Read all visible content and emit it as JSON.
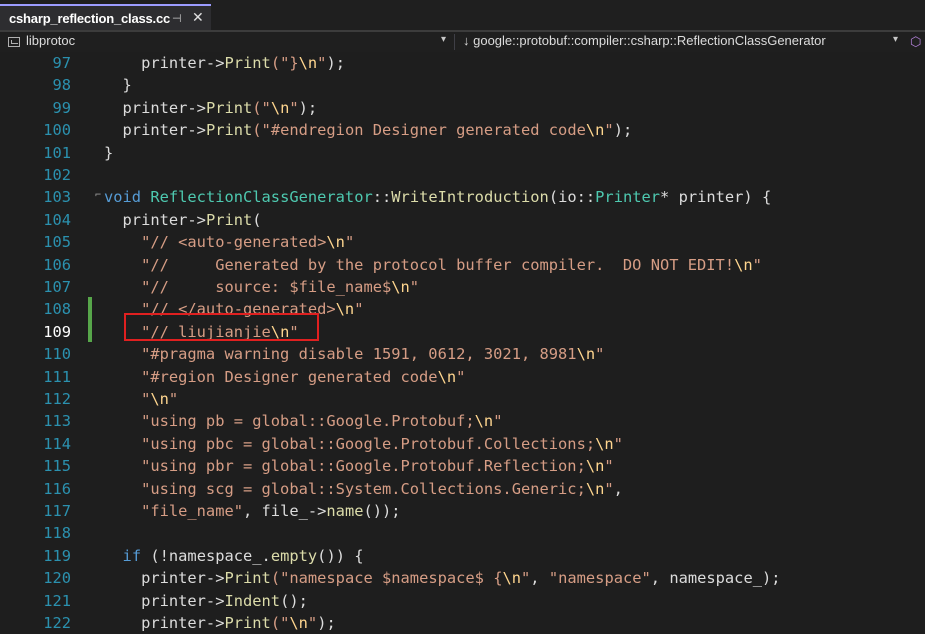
{
  "tab": {
    "title": "csharp_reflection_class.cc",
    "pin_glyph": "⊣",
    "close_glyph": "✕"
  },
  "nav": {
    "project": "libprotoc",
    "scope": "↓ google::protobuf::compiler::csharp::ReflectionClassGenerator"
  },
  "colors": {
    "plain": "#dcdcdc",
    "string": "#d69d85",
    "escape": "#ffd68f",
    "keyword": "#569cd6",
    "function": "#dcdcaa",
    "type": "#4ec9b0",
    "line_number": "#2b91af"
  },
  "lines": [
    {
      "n": "97",
      "tokens": [
        [
          "    printer->",
          "p"
        ],
        [
          "Print",
          "f"
        ],
        [
          "(\"}",
          "s"
        ],
        [
          "\\n",
          "e"
        ],
        [
          "\"",
          "s"
        ],
        [
          ");",
          "p"
        ]
      ]
    },
    {
      "n": "98",
      "tokens": [
        [
          "  }",
          "p"
        ]
      ]
    },
    {
      "n": "99",
      "tokens": [
        [
          "  printer->",
          "p"
        ],
        [
          "Print",
          "f"
        ],
        [
          "(\"",
          "s"
        ],
        [
          "\\n",
          "e"
        ],
        [
          "\"",
          "s"
        ],
        [
          ");",
          "p"
        ]
      ]
    },
    {
      "n": "100",
      "tokens": [
        [
          "  printer->",
          "p"
        ],
        [
          "Print",
          "f"
        ],
        [
          "(\"#endregion Designer generated code",
          "s"
        ],
        [
          "\\n",
          "e"
        ],
        [
          "\"",
          "s"
        ],
        [
          ");",
          "p"
        ]
      ]
    },
    {
      "n": "101",
      "tokens": [
        [
          "}",
          "p"
        ]
      ]
    },
    {
      "n": "102",
      "tokens": []
    },
    {
      "n": "103",
      "tokens": [
        [
          "void ",
          "k"
        ],
        [
          "ReflectionClassGenerator",
          "t"
        ],
        [
          "::",
          "p"
        ],
        [
          "WriteIntroduction",
          "f"
        ],
        [
          "(io::",
          "p"
        ],
        [
          "Printer",
          "t"
        ],
        [
          "* printer) {",
          "p"
        ]
      ]
    },
    {
      "n": "104",
      "tokens": [
        [
          "  printer->",
          "p"
        ],
        [
          "Print",
          "f"
        ],
        [
          "(",
          "p"
        ]
      ]
    },
    {
      "n": "105",
      "tokens": [
        [
          "    \"// <auto-generated>",
          "s"
        ],
        [
          "\\n",
          "e"
        ],
        [
          "\"",
          "s"
        ]
      ]
    },
    {
      "n": "106",
      "tokens": [
        [
          "    \"//     Generated by the protocol buffer compiler.  DO NOT EDIT!",
          "s"
        ],
        [
          "\\n",
          "e"
        ],
        [
          "\"",
          "s"
        ]
      ]
    },
    {
      "n": "107",
      "tokens": [
        [
          "    \"//     source: $file_name$",
          "s"
        ],
        [
          "\\n",
          "e"
        ],
        [
          "\"",
          "s"
        ]
      ]
    },
    {
      "n": "108",
      "tokens": [
        [
          "    \"// </auto-generated>",
          "s"
        ],
        [
          "\\n",
          "e"
        ],
        [
          "\"",
          "s"
        ]
      ]
    },
    {
      "n": "109",
      "tokens": [
        [
          "    \"// liujianjie",
          "s"
        ],
        [
          "\\n",
          "e"
        ],
        [
          "\"",
          "s"
        ]
      ]
    },
    {
      "n": "110",
      "tokens": [
        [
          "    \"#pragma warning disable 1591, 0612, 3021, 8981",
          "s"
        ],
        [
          "\\n",
          "e"
        ],
        [
          "\"",
          "s"
        ]
      ]
    },
    {
      "n": "111",
      "tokens": [
        [
          "    \"#region Designer generated code",
          "s"
        ],
        [
          "\\n",
          "e"
        ],
        [
          "\"",
          "s"
        ]
      ]
    },
    {
      "n": "112",
      "tokens": [
        [
          "    \"",
          "s"
        ],
        [
          "\\n",
          "e"
        ],
        [
          "\"",
          "s"
        ]
      ]
    },
    {
      "n": "113",
      "tokens": [
        [
          "    \"using pb = global::Google.Protobuf;",
          "s"
        ],
        [
          "\\n",
          "e"
        ],
        [
          "\"",
          "s"
        ]
      ]
    },
    {
      "n": "114",
      "tokens": [
        [
          "    \"using pbc = global::Google.Protobuf.Collections;",
          "s"
        ],
        [
          "\\n",
          "e"
        ],
        [
          "\"",
          "s"
        ]
      ]
    },
    {
      "n": "115",
      "tokens": [
        [
          "    \"using pbr = global::Google.Protobuf.Reflection;",
          "s"
        ],
        [
          "\\n",
          "e"
        ],
        [
          "\"",
          "s"
        ]
      ]
    },
    {
      "n": "116",
      "tokens": [
        [
          "    \"using scg = global::System.Collections.Generic;",
          "s"
        ],
        [
          "\\n",
          "e"
        ],
        [
          "\"",
          "s"
        ],
        [
          ",",
          "p"
        ]
      ]
    },
    {
      "n": "117",
      "tokens": [
        [
          "    \"file_name\"",
          "s"
        ],
        [
          ", file_->",
          "p"
        ],
        [
          "name",
          "f"
        ],
        [
          "());",
          "p"
        ]
      ]
    },
    {
      "n": "118",
      "tokens": []
    },
    {
      "n": "119",
      "tokens": [
        [
          "  ",
          "p"
        ],
        [
          "if",
          "k"
        ],
        [
          " (!namespace_.",
          "p"
        ],
        [
          "empty",
          "f"
        ],
        [
          "()) {",
          "p"
        ]
      ]
    },
    {
      "n": "120",
      "tokens": [
        [
          "    printer->",
          "p"
        ],
        [
          "Print",
          "f"
        ],
        [
          "(\"namespace $namespace$ {",
          "s"
        ],
        [
          "\\n",
          "e"
        ],
        [
          "\"",
          "s"
        ],
        [
          ", ",
          "p"
        ],
        [
          "\"namespace\"",
          "s"
        ],
        [
          ", namespace_);",
          "p"
        ]
      ]
    },
    {
      "n": "121",
      "tokens": [
        [
          "    printer->",
          "p"
        ],
        [
          "Indent",
          "f"
        ],
        [
          "();",
          "p"
        ]
      ]
    },
    {
      "n": "122",
      "tokens": [
        [
          "    printer->",
          "p"
        ],
        [
          "Print",
          "f"
        ],
        [
          "(\"",
          "s"
        ],
        [
          "\\n",
          "e"
        ],
        [
          "\"",
          "s"
        ],
        [
          ");",
          "p"
        ]
      ]
    }
  ]
}
